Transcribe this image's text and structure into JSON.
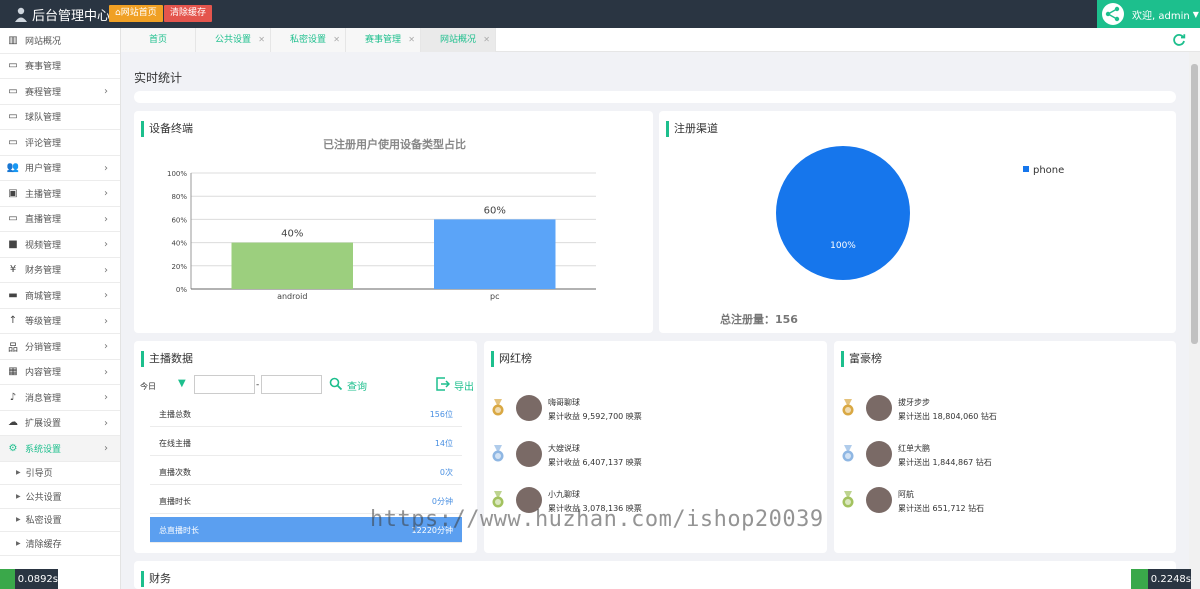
{
  "header": {
    "title": "后台管理中心",
    "home_button": "网站首页",
    "clear_button": "清除缓存",
    "user_label": "欢迎, admin"
  },
  "sidebar": {
    "items": [
      {
        "label": "网站概况",
        "icon": "bar-chart-icon",
        "chevron": false
      },
      {
        "label": "赛事管理",
        "icon": "monitor-icon",
        "chevron": false
      },
      {
        "label": "赛程管理",
        "icon": "monitor-icon",
        "chevron": true
      },
      {
        "label": "球队管理",
        "icon": "monitor-icon",
        "chevron": false
      },
      {
        "label": "评论管理",
        "icon": "monitor-icon",
        "chevron": false
      },
      {
        "label": "用户管理",
        "icon": "users-icon",
        "chevron": true
      },
      {
        "label": "主播管理",
        "icon": "user-card-icon",
        "chevron": true
      },
      {
        "label": "直播管理",
        "icon": "monitor-icon",
        "chevron": true
      },
      {
        "label": "视频管理",
        "icon": "video-icon",
        "chevron": true
      },
      {
        "label": "财务管理",
        "icon": "yen-icon",
        "chevron": true
      },
      {
        "label": "商城管理",
        "icon": "truck-icon",
        "chevron": true
      },
      {
        "label": "等级管理",
        "icon": "level-up-icon",
        "chevron": true
      },
      {
        "label": "分销管理",
        "icon": "sitemap-icon",
        "chevron": true
      },
      {
        "label": "内容管理",
        "icon": "grid-icon",
        "chevron": true
      },
      {
        "label": "消息管理",
        "icon": "bell-icon",
        "chevron": true
      },
      {
        "label": "扩展设置",
        "icon": "cloud-icon",
        "chevron": true
      },
      {
        "label": "系统设置",
        "icon": "gears-icon",
        "chevron": true,
        "active": true
      }
    ],
    "subitems": [
      "引导页",
      "公共设置",
      "私密设置",
      "清除缓存"
    ],
    "timing": "0.0892s"
  },
  "tabs": [
    {
      "label": "首页",
      "closable": false
    },
    {
      "label": "公共设置",
      "closable": true
    },
    {
      "label": "私密设置",
      "closable": true
    },
    {
      "label": "赛事管理",
      "closable": true
    },
    {
      "label": "网站概况",
      "closable": true,
      "current": true
    }
  ],
  "page_title": "实时统计",
  "device_card": {
    "title": "设备终端",
    "chart_data": {
      "type": "bar",
      "title": "已注册用户使用设备类型占比",
      "categories": [
        "android",
        "pc"
      ],
      "values": [
        40,
        60
      ],
      "value_labels": [
        "40%",
        "60%"
      ],
      "yticks": [
        "0%",
        "20%",
        "40%",
        "60%",
        "80%",
        "100%"
      ],
      "ylim": [
        0,
        100
      ],
      "colors": [
        "#9ccf7e",
        "#5ba4f8"
      ],
      "grid": true
    }
  },
  "channel_card": {
    "title": "注册渠道",
    "chart_data": {
      "type": "pie",
      "categories": [
        "phone"
      ],
      "values": [
        100
      ],
      "slice_labels": [
        "100%"
      ],
      "colors": [
        "#1676ec"
      ],
      "legend": "top-right"
    },
    "total_label": "总注册量：",
    "total_value": "156"
  },
  "anchor_card": {
    "title": "主播数据",
    "period": "今日",
    "separator": "-",
    "query": "查询",
    "export": "导出",
    "rows": [
      {
        "label": "主播总数",
        "value": "156位"
      },
      {
        "label": "在线主播",
        "value": "14位"
      },
      {
        "label": "直播次数",
        "value": "0次"
      },
      {
        "label": "直播时长",
        "value": "0分钟"
      },
      {
        "label": "总直播时长",
        "value": "12220分钟",
        "highlight": true
      }
    ]
  },
  "influencer_card": {
    "title": "网红榜",
    "entries": [
      {
        "name": "嗨哥聊球",
        "stat": "累计收益 9,592,700 映票",
        "medal": "#d9a843"
      },
      {
        "name": "大嫂说球",
        "stat": "累计收益 6,407,137 映票",
        "medal": "#8fb7e3"
      },
      {
        "name": "小九聊球",
        "stat": "累计收益 3,078,136 映票",
        "medal": "#a3c25f"
      }
    ]
  },
  "rich_card": {
    "title": "富豪榜",
    "entries": [
      {
        "name": "拔牙步步",
        "stat": "累计送出 18,804,060 钻石",
        "medal": "#d9a843"
      },
      {
        "name": "红单大鹏",
        "stat": "累计送出 1,844,867 钻石",
        "medal": "#8fb7e3"
      },
      {
        "name": "阿航",
        "stat": "累计送出 651,712 钻石",
        "medal": "#a3c25f"
      }
    ]
  },
  "finance_card": {
    "title": "财务"
  },
  "timing_right": "0.2248s",
  "watermark": "https://www.huzhan.com/ishop20039",
  "colors": {
    "accent": "#1dbf8d",
    "topbar": "#2a3542",
    "home_button": "#f0a024",
    "clear_button": "#e4554d"
  }
}
